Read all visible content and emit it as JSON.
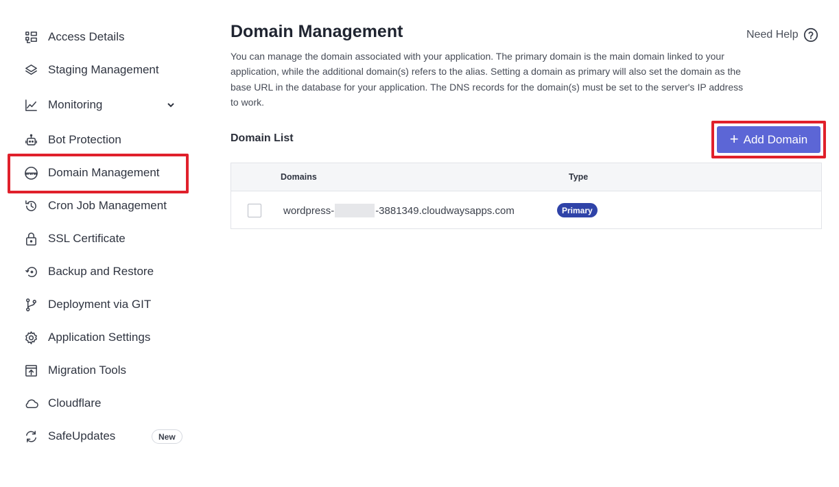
{
  "sidebar": {
    "items": [
      {
        "label": "Access Details",
        "icon": "access-details-icon"
      },
      {
        "label": "Staging Management",
        "icon": "layers-icon"
      },
      {
        "label": "Monitoring",
        "icon": "line-chart-icon"
      },
      {
        "label": "Bot Protection",
        "icon": "robot-icon"
      },
      {
        "label": "Domain Management",
        "icon": "www-globe-icon"
      },
      {
        "label": "Cron Job Management",
        "icon": "clock-history-icon"
      },
      {
        "label": "SSL Certificate",
        "icon": "lock-icon"
      },
      {
        "label": "Backup and Restore",
        "icon": "restore-icon"
      },
      {
        "label": "Deployment via GIT",
        "icon": "git-branch-icon"
      },
      {
        "label": "Application Settings",
        "icon": "gear-icon"
      },
      {
        "label": "Migration Tools",
        "icon": "migration-icon"
      },
      {
        "label": "Cloudflare",
        "icon": "cloud-icon"
      },
      {
        "label": "SafeUpdates",
        "icon": "refresh-icon",
        "badge": "New"
      }
    ],
    "active": "Domain Management"
  },
  "header": {
    "title": "Domain Management",
    "help_label": "Need Help",
    "description": "You can manage the domain associated with your application. The primary domain is the main domain linked to your application, while the additional domain(s) refers to the alias. Setting a domain as primary will also set the domain as the base URL in the database for your application. The DNS records for the domain(s) must be set to the server's IP address to work."
  },
  "domain_list": {
    "title": "Domain List",
    "add_button": "Add Domain",
    "columns": [
      "Domains",
      "Type"
    ],
    "rows": [
      {
        "domain_prefix": "wordpress-",
        "domain_suffix": "-3881349.cloudwaysapps.com",
        "type": "Primary"
      }
    ]
  },
  "colors": {
    "accent": "#5c66d6",
    "primary_badge": "#2f43a8",
    "highlight": "#e0202b"
  }
}
